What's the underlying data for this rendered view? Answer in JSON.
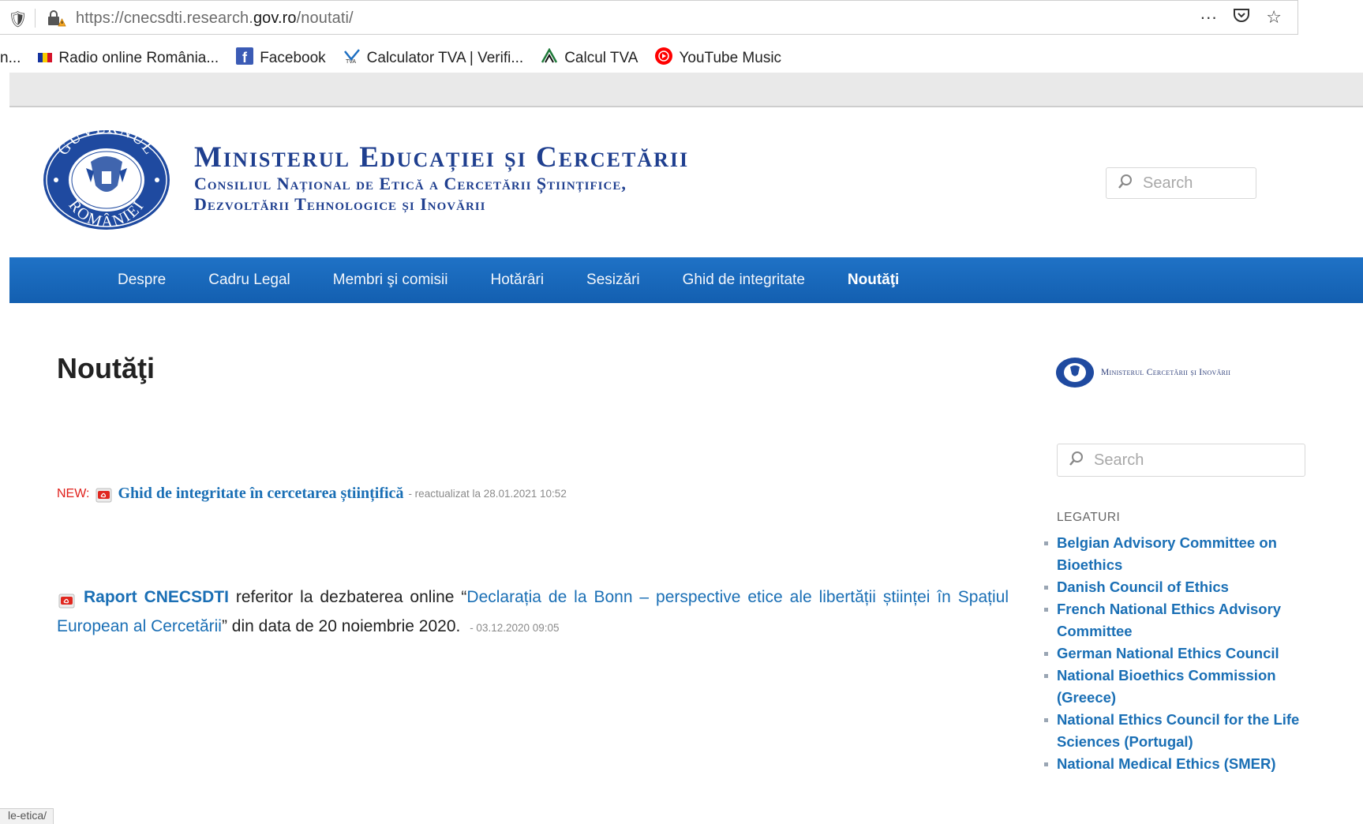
{
  "browser": {
    "url_prefix": "https://cnecsdti.research.",
    "url_domain": "gov.ro",
    "url_path": "/noutati/",
    "more_glyph": "···",
    "bookmarks": [
      {
        "label": "n...",
        "icon": "none"
      },
      {
        "label": "Radio online România...",
        "icon": "romanian-flag-icon"
      },
      {
        "label": "Facebook",
        "icon": "facebook-icon"
      },
      {
        "label": "Calculator TVA | Verifi...",
        "icon": "tva-icon"
      },
      {
        "label": "Calcul TVA",
        "icon": "triangle-logo-icon"
      },
      {
        "label": "YouTube Music",
        "icon": "youtube-music-icon"
      }
    ],
    "status_text": "le-etica/"
  },
  "header": {
    "title": "Ministerul Educației și Cercetării",
    "subtitle_line1": "Consiliul Național de Etică a Cercetării Științifice,",
    "subtitle_line2": "Dezvoltării Tehnologice și Inovării",
    "seal_top_text": "GUVERNUL",
    "seal_bottom_text": "ROMÂNIEI",
    "search_placeholder": "Search"
  },
  "nav": {
    "items": [
      "Despre",
      "Cadru Legal",
      "Membri şi comisii",
      "Hotărâri",
      "Sesizări",
      "Ghid de integritate",
      "Noutăţi"
    ],
    "active_index": 6
  },
  "main": {
    "page_title": "Noutăţi",
    "news1": {
      "new_label": "NEW:",
      "link": "Ghid de integritate în cercetarea științifică",
      "meta": "- reactualizat la 28.01.2021 10:52"
    },
    "news2": {
      "link_bold": "Raport CNECSDTI",
      "text1": " referitor la dezbaterea online “",
      "link_title": "Declarația de la Bonn – perspective etice ale libertății științei în Spațiul European al Cercetării",
      "text2": "” din data de 20 noiembrie 2020.",
      "meta": "- 03.12.2020 09:05"
    }
  },
  "sidebar": {
    "logo_text": "Ministerul Cercetării și Inovării",
    "search_placeholder": "Search",
    "heading": "LEGATURI",
    "links": [
      "Belgian Advisory Committee on Bioethics",
      "Danish Council of Ethics",
      "French National Ethics Advisory Committee",
      "German National Ethics Council",
      "National Bioethics Commission (Greece)",
      "National Ethics Council for the Life Sciences (Portugal)",
      "National Medical Ethics (SMER)"
    ]
  },
  "colors": {
    "nav_blue": "#1a68bb",
    "link_blue": "#1a6fb5",
    "title_blue": "#1f3f8f",
    "new_red": "#e0201b"
  }
}
